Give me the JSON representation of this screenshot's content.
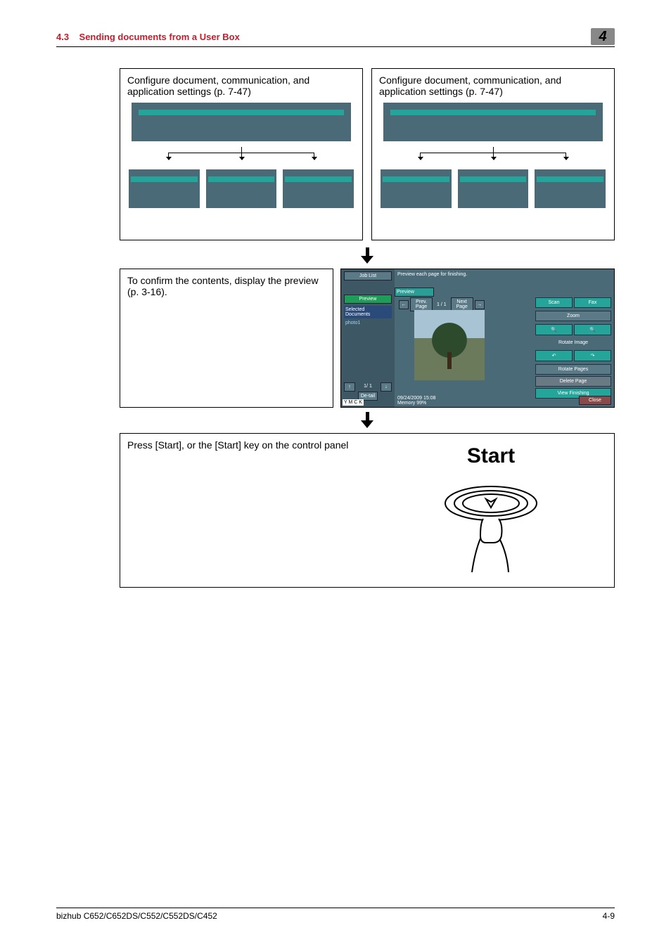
{
  "header": {
    "section_number": "4.3",
    "section_title": "Sending documents from a User Box",
    "chapter_number": "4"
  },
  "step1": {
    "text_left": "Configure document, communication, and application settings (p. 7-47)",
    "text_right": "Configure document, communication, and application settings (p. 7-47)"
  },
  "step2": {
    "text": "To confirm the contents, display the preview (p. 3-16).",
    "preview": {
      "job_list": "Job List",
      "title": "Preview each page for finishing.",
      "preview_header": "Preview",
      "preview_btn": "Preview",
      "selected_docs": "Selected Documents",
      "doc_name": "photo1",
      "prev_page": "Prev. Page",
      "page_indicator": "1 / 1",
      "next_page": "Next Page",
      "scan": "Scan",
      "fax": "Fax",
      "zoom": "Zoom",
      "rotate_image": "Rotate Image",
      "rotate_pages": "Rotate Pages",
      "delete_page": "Delete Page",
      "view_finishing": "View Finishing",
      "close": "Close",
      "datetime": "09/24/2009  15:08",
      "memory": "Memory   99%",
      "ymck": "Y M C K",
      "detail": "De-tail"
    }
  },
  "step3": {
    "text": "Press [Start], or the [Start] key on the control panel",
    "start_label": "Start"
  },
  "footer": {
    "model": "bizhub C652/C652DS/C552/C552DS/C452",
    "page": "4-9"
  }
}
